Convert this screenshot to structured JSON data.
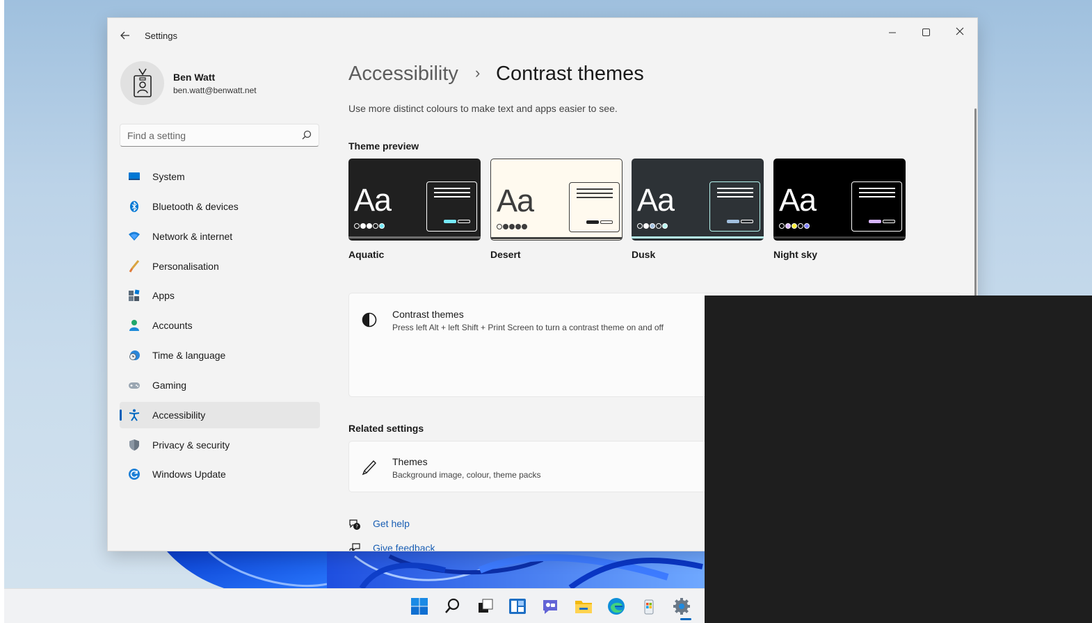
{
  "window": {
    "app_title": "Settings",
    "back_icon": "back-arrow-icon",
    "controls": {
      "minimize": "—",
      "maximize": "☐",
      "close": "✕"
    }
  },
  "user": {
    "name": "Ben Watt",
    "email": "ben.watt@benwatt.net"
  },
  "search": {
    "placeholder": "Find a setting"
  },
  "nav": {
    "items": [
      {
        "label": "System",
        "icon": "system-display-icon"
      },
      {
        "label": "Bluetooth & devices",
        "icon": "bluetooth-icon"
      },
      {
        "label": "Network & internet",
        "icon": "wifi-icon"
      },
      {
        "label": "Personalisation",
        "icon": "brush-icon"
      },
      {
        "label": "Apps",
        "icon": "apps-icon"
      },
      {
        "label": "Accounts",
        "icon": "account-icon"
      },
      {
        "label": "Time & language",
        "icon": "globe-clock-icon"
      },
      {
        "label": "Gaming",
        "icon": "gamepad-icon"
      },
      {
        "label": "Accessibility",
        "icon": "accessibility-icon",
        "active": true
      },
      {
        "label": "Privacy & security",
        "icon": "shield-icon"
      },
      {
        "label": "Windows Update",
        "icon": "update-icon"
      }
    ]
  },
  "breadcrumb": {
    "parent": "Accessibility",
    "separator": "›",
    "current": "Contrast themes"
  },
  "description": "Use more distinct colours to make text and apps easier to see.",
  "theme_preview": {
    "title": "Theme preview",
    "themes": [
      {
        "name": "Aquatic",
        "aa": "Aa",
        "bg": "#202020",
        "text": "#ffffff",
        "win_bg": "#202020",
        "win_border": "#ffffff",
        "dots": [
          "#202020",
          "#ffffff",
          "#ffffff",
          "#202020",
          "#75e9fc"
        ],
        "b1": "#75e9fc",
        "b2": "#202020",
        "bottom": "#6e6e6e"
      },
      {
        "name": "Desert",
        "aa": "Aa",
        "bg": "#fffaef",
        "text": "#3d3d3d",
        "win_bg": "#fffaef",
        "win_border": "#3d3d3d",
        "dots": [
          "#fffaef",
          "#3d3d3d",
          "#3d3d3d",
          "#3d3d3d",
          "#3d3d3d"
        ],
        "b1": "#202020",
        "b2": "#fffaef",
        "bottom": "#3d3d3d"
      },
      {
        "name": "Dusk",
        "aa": "Aa",
        "bg": "#2d3236",
        "text": "#ffffff",
        "win_bg": "#2d3236",
        "win_border": "#b6f6f0",
        "dots": [
          "#2d3236",
          "#ffffff",
          "#a1bfde",
          "#2d3236",
          "#b6f6f0"
        ],
        "b1": "#a1bfde",
        "b2": "#2d3236",
        "bottom": "#b6f6f0"
      },
      {
        "name": "Night sky",
        "aa": "Aa",
        "bg": "#000000",
        "text": "#ffffff",
        "win_bg": "#000000",
        "win_border": "#ffffff",
        "dots": [
          "#000000",
          "#d6b4fd",
          "#ffee32",
          "#000000",
          "#8080ff"
        ],
        "b1": "#d6b4fd",
        "b2": "#000000",
        "bottom": "#3d3d3d"
      }
    ]
  },
  "contrast_card": {
    "icon": "contrast-half-circle-icon",
    "title": "Contrast themes",
    "subtitle": "Press left Alt + left Shift + Print Screen to turn a contrast theme on and off"
  },
  "related_settings": {
    "title": "Related settings",
    "items": [
      {
        "icon": "pen-icon",
        "title": "Themes",
        "subtitle": "Background image, colour, theme packs"
      }
    ]
  },
  "help_links": [
    {
      "label": "Get help",
      "icon": "help-chat-icon"
    },
    {
      "label": "Give feedback",
      "icon": "feedback-icon"
    }
  ],
  "taskbar": {
    "icons": [
      "windows-start-icon",
      "search-icon",
      "task-view-icon",
      "widgets-icon",
      "chat-icon",
      "file-explorer-icon",
      "edge-icon",
      "store-icon",
      "settings-gear-icon"
    ],
    "active": "settings-gear-icon"
  },
  "colors": {
    "accent": "#005fb8",
    "link": "#1a5fb4",
    "window_bg": "#f3f3f3",
    "card_bg": "#fbfbfb"
  }
}
